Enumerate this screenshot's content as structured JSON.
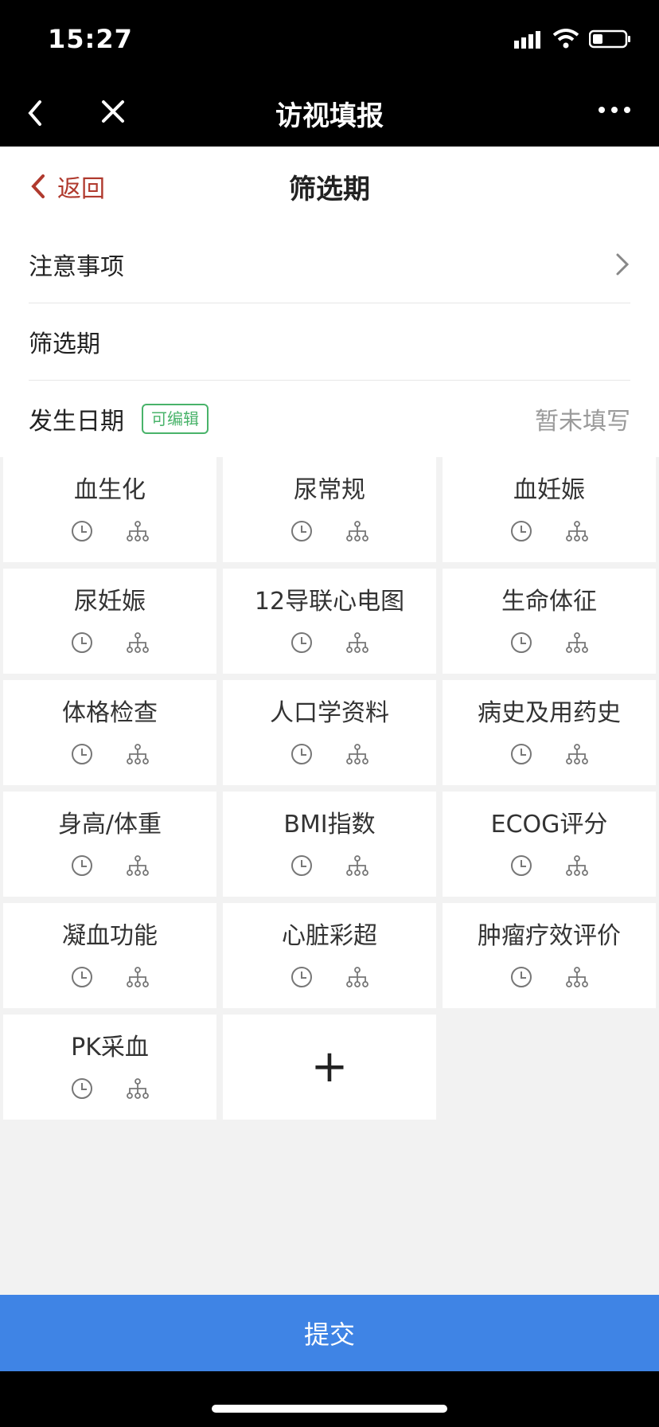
{
  "status": {
    "time": "15:27"
  },
  "wechat": {
    "title": "访视填报"
  },
  "nav": {
    "back_label": "返回",
    "title": "筛选期"
  },
  "rows": [
    {
      "label": "注意事项"
    },
    {
      "label": "筛选期"
    },
    {
      "label": "发生日期",
      "badge": "可编辑",
      "value": "暂未填写"
    }
  ],
  "tiles": [
    {
      "label": "血生化"
    },
    {
      "label": "尿常规"
    },
    {
      "label": "血妊娠"
    },
    {
      "label": "尿妊娠"
    },
    {
      "label": "12导联心电图"
    },
    {
      "label": "生命体征"
    },
    {
      "label": "体格检查"
    },
    {
      "label": "人口学资料"
    },
    {
      "label": "病史及用药史"
    },
    {
      "label": "身高/体重"
    },
    {
      "label": "BMI指数"
    },
    {
      "label": "ECOG评分"
    },
    {
      "label": "凝血功能"
    },
    {
      "label": "心脏彩超"
    },
    {
      "label": "肿瘤疗效评价"
    },
    {
      "label": "PK采血"
    }
  ],
  "add_tile": {
    "symbol": "+"
  },
  "submit": {
    "label": "提交"
  },
  "colors": {
    "accent_red": "#b03a2e",
    "badge_green": "#49b36a",
    "submit_blue": "#3f84e5"
  },
  "icons": [
    "clock-icon",
    "hierarchy-icon",
    "chevron-right-icon",
    "back-chevron-icon",
    "close-icon",
    "more-icon"
  ]
}
